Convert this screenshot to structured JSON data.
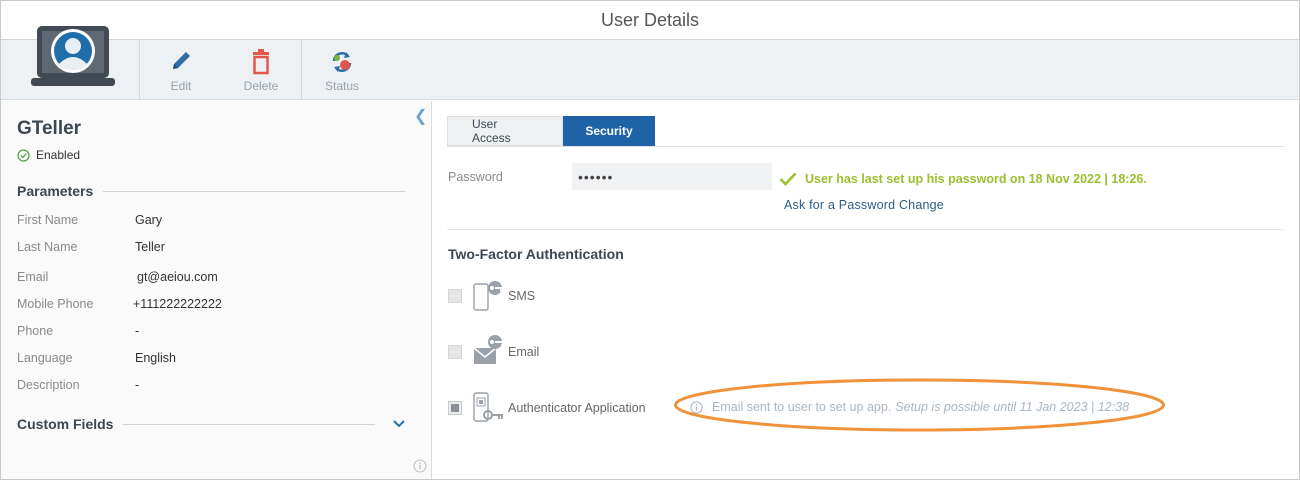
{
  "window": {
    "title": "User Details"
  },
  "toolbar": {
    "buttons": [
      {
        "label": "Edit",
        "icon": "pencil-icon"
      },
      {
        "label": "Delete",
        "icon": "trash-icon"
      },
      {
        "label": "Status",
        "icon": "status-cycle-icon"
      }
    ]
  },
  "user": {
    "name": "GTeller",
    "status": "Enabled"
  },
  "parameters": {
    "heading": "Parameters",
    "rows": [
      {
        "key": "First Name",
        "value": "Gary"
      },
      {
        "key": "Last Name",
        "value": "Teller"
      },
      {
        "key": "Email",
        "value": "gt@aeiou.com"
      },
      {
        "key": "Mobile Phone",
        "value": "+111222222222"
      },
      {
        "key": "Phone",
        "value": "-"
      },
      {
        "key": "Language",
        "value": "English"
      },
      {
        "key": "Description",
        "value": "-"
      }
    ]
  },
  "custom_fields": {
    "heading": "Custom Fields"
  },
  "tabs": [
    {
      "label": "User Access",
      "active": false
    },
    {
      "label": "Security",
      "active": true
    }
  ],
  "security": {
    "password_label": "Password",
    "password_value": "••••••",
    "password_status": "User has last set up his password on 18 Nov 2022 | 18:26.",
    "password_change_link": "Ask for a Password Change",
    "tfa_title": "Two-Factor Authentication",
    "tfa_methods": [
      {
        "label": "SMS",
        "checked": false,
        "icon": "phone-key-icon"
      },
      {
        "label": "Email",
        "checked": false,
        "icon": "envelope-key-icon"
      },
      {
        "label": "Authenticator Application",
        "checked": true,
        "icon": "qr-phone-key-icon"
      }
    ],
    "authenticator_note": "Email sent to user to set up app.",
    "authenticator_note_italic": "Setup is possible until 11 Jan 2023 | 12:38"
  },
  "colors": {
    "accent": "#1d63a6",
    "success": "#9bbf2e",
    "highlight": "#f0923a",
    "delete": "#e2574c"
  }
}
